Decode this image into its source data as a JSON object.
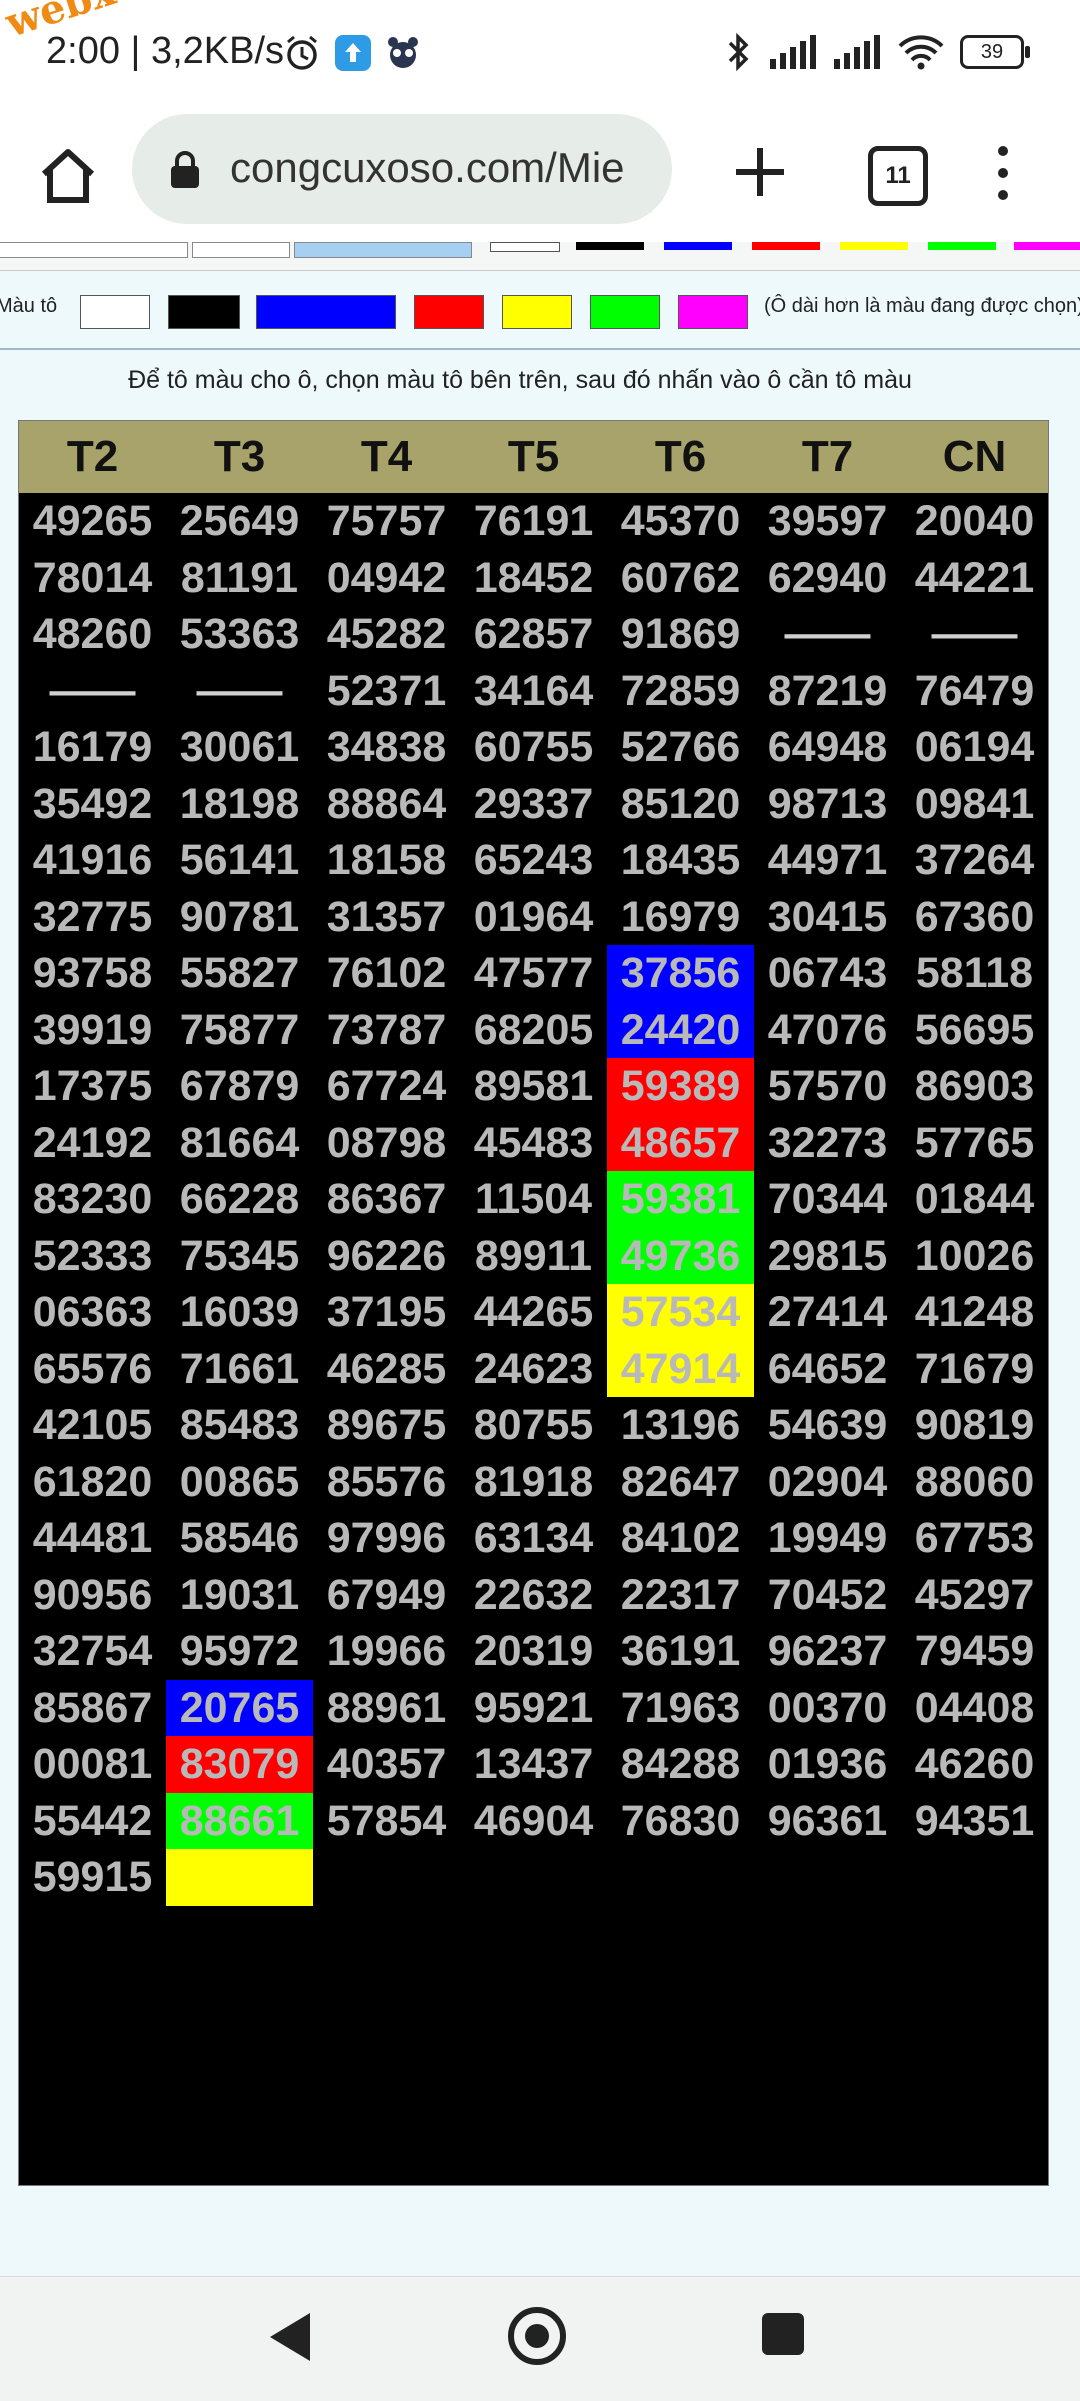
{
  "status": {
    "time": "2:00",
    "speed": "3,2KB/s",
    "battery": "39",
    "watermark": "webxoso.net"
  },
  "browser": {
    "url": "congcuxoso.com/Mie",
    "tab_count": "11"
  },
  "palette": {
    "label": "Màu tô",
    "swatches": [
      "#ffffff",
      "#000000",
      "#0000ff",
      "#ff0000",
      "#ffff00",
      "#00ff00",
      "#ff00ff"
    ],
    "note": "(Ô dài hơn là màu đang được chọn)"
  },
  "instruction": "Để tô màu cho ô, chọn màu tô bên trên, sau đó nhấn vào ô cần tô màu",
  "grid": {
    "headers": [
      "T2",
      "T3",
      "T4",
      "T5",
      "T6",
      "T7",
      "CN"
    ],
    "rows": [
      [
        "49265",
        "25649",
        "75757",
        "76191",
        "45370",
        "39597",
        "20040"
      ],
      [
        "78014",
        "81191",
        "04942",
        "18452",
        "60762",
        "62940",
        "44221"
      ],
      [
        "48260",
        "53363",
        "45282",
        "62857",
        "91869",
        "——",
        "——"
      ],
      [
        "——",
        "——",
        "52371",
        "34164",
        "72859",
        "87219",
        "76479"
      ],
      [
        "16179",
        "30061",
        "34838",
        "60755",
        "52766",
        "64948",
        "06194"
      ],
      [
        "35492",
        "18198",
        "88864",
        "29337",
        "85120",
        "98713",
        "09841"
      ],
      [
        "41916",
        "56141",
        "18158",
        "65243",
        "18435",
        "44971",
        "37264"
      ],
      [
        "32775",
        "90781",
        "31357",
        "01964",
        "16979",
        "30415",
        "67360"
      ],
      [
        "93758",
        "55827",
        "76102",
        "47577",
        "37856",
        "06743",
        "58118"
      ],
      [
        "39919",
        "75877",
        "73787",
        "68205",
        "24420",
        "47076",
        "56695"
      ],
      [
        "17375",
        "67879",
        "67724",
        "89581",
        "59389",
        "57570",
        "86903"
      ],
      [
        "24192",
        "81664",
        "08798",
        "45483",
        "48657",
        "32273",
        "57765"
      ],
      [
        "83230",
        "66228",
        "86367",
        "11504",
        "59381",
        "70344",
        "01844"
      ],
      [
        "52333",
        "75345",
        "96226",
        "89911",
        "49736",
        "29815",
        "10026"
      ],
      [
        "06363",
        "16039",
        "37195",
        "44265",
        "57534",
        "27414",
        "41248"
      ],
      [
        "65576",
        "71661",
        "46285",
        "24623",
        "47914",
        "64652",
        "71679"
      ],
      [
        "42105",
        "85483",
        "89675",
        "80755",
        "13196",
        "54639",
        "90819"
      ],
      [
        "61820",
        "00865",
        "85576",
        "81918",
        "82647",
        "02904",
        "88060"
      ],
      [
        "44481",
        "58546",
        "97996",
        "63134",
        "84102",
        "19949",
        "67753"
      ],
      [
        "90956",
        "19031",
        "67949",
        "22632",
        "22317",
        "70452",
        "45297"
      ],
      [
        "32754",
        "95972",
        "19966",
        "20319",
        "36191",
        "96237",
        "79459"
      ],
      [
        "85867",
        "20765",
        "88961",
        "95921",
        "71963",
        "00370",
        "04408"
      ],
      [
        "00081",
        "83079",
        "40357",
        "13437",
        "84288",
        "01936",
        "46260"
      ],
      [
        "55442",
        "88661",
        "57854",
        "46904",
        "76830",
        "96361",
        "94351"
      ],
      [
        "59915",
        "",
        "",
        "",
        "",
        "",
        ""
      ]
    ],
    "highlights": [
      {
        "row": 8,
        "col": 4,
        "color": "#0000ff"
      },
      {
        "row": 9,
        "col": 4,
        "color": "#0000ff"
      },
      {
        "row": 10,
        "col": 4,
        "color": "#ff0000"
      },
      {
        "row": 11,
        "col": 4,
        "color": "#ff0000"
      },
      {
        "row": 12,
        "col": 4,
        "color": "#00ff00"
      },
      {
        "row": 13,
        "col": 4,
        "color": "#00ff00"
      },
      {
        "row": 14,
        "col": 4,
        "color": "#ffff00"
      },
      {
        "row": 15,
        "col": 4,
        "color": "#ffff00"
      },
      {
        "row": 21,
        "col": 1,
        "color": "#0000ff"
      },
      {
        "row": 22,
        "col": 1,
        "color": "#ff0000"
      },
      {
        "row": 23,
        "col": 1,
        "color": "#00ff00"
      },
      {
        "row": 24,
        "col": 1,
        "color": "#ffff00"
      }
    ]
  }
}
